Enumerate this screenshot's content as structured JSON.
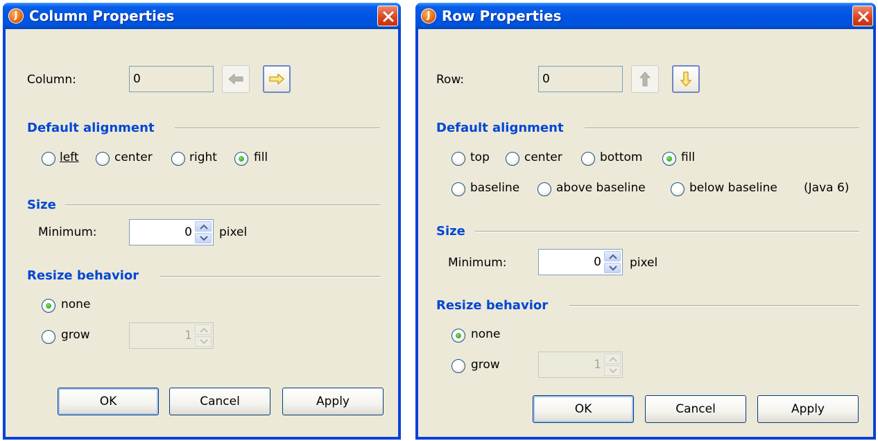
{
  "column_dialog": {
    "title": "Column Properties",
    "index_label": "Column:",
    "index_value": "0",
    "prev_icon": "arrow-left-icon",
    "next_icon": "arrow-right-icon",
    "default_alignment": {
      "heading": "Default alignment",
      "options": [
        {
          "label": "left",
          "selected": false
        },
        {
          "label": "center",
          "selected": false
        },
        {
          "label": "right",
          "selected": false
        },
        {
          "label": "fill",
          "selected": true
        }
      ]
    },
    "size": {
      "heading": "Size",
      "minimum_label": "Minimum:",
      "minimum_value": "0",
      "unit": "pixel"
    },
    "resize": {
      "heading": "Resize behavior",
      "none_label": "none",
      "none_selected": true,
      "grow_label": "grow",
      "grow_selected": false,
      "grow_value": "1"
    },
    "buttons": {
      "ok": "OK",
      "cancel": "Cancel",
      "apply": "Apply"
    }
  },
  "row_dialog": {
    "title": "Row Properties",
    "index_label": "Row:",
    "index_value": "0",
    "prev_icon": "arrow-up-icon",
    "next_icon": "arrow-down-icon",
    "default_alignment": {
      "heading": "Default alignment",
      "options": [
        {
          "label": "top",
          "selected": false
        },
        {
          "label": "center",
          "selected": false
        },
        {
          "label": "bottom",
          "selected": false
        },
        {
          "label": "fill",
          "selected": true
        },
        {
          "label": "baseline",
          "selected": false
        },
        {
          "label": "above baseline",
          "selected": false
        },
        {
          "label": "below baseline",
          "selected": false
        }
      ],
      "java_note": "(Java 6)"
    },
    "size": {
      "heading": "Size",
      "minimum_label": "Minimum:",
      "minimum_value": "0",
      "unit": "pixel"
    },
    "resize": {
      "heading": "Resize behavior",
      "none_label": "none",
      "none_selected": true,
      "grow_label": "grow",
      "grow_selected": false,
      "grow_value": "1"
    },
    "buttons": {
      "ok": "OK",
      "cancel": "Cancel",
      "apply": "Apply"
    }
  },
  "colors": {
    "titlebar": "#0054e3",
    "section_heading": "#0046d5",
    "dialog_bg": "#ece9d8"
  }
}
